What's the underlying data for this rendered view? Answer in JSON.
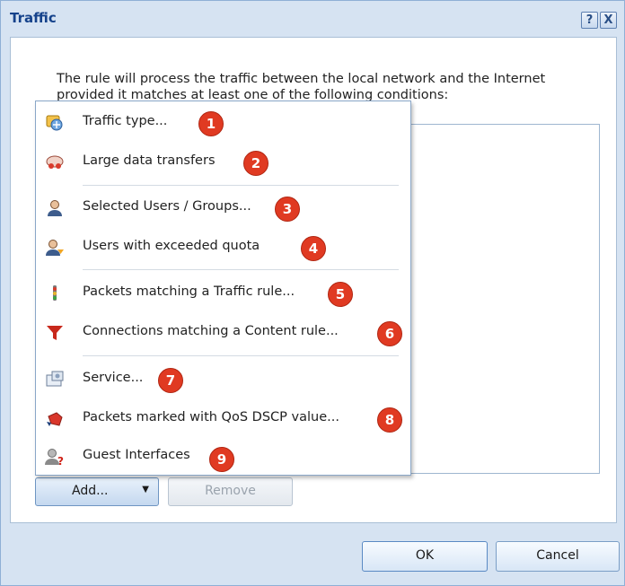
{
  "dialog": {
    "title": "Traffic",
    "help_label": "?",
    "close_label": "X",
    "description": "The rule will process the traffic between the local network and the Internet provided it matches at least one of the following conditions:"
  },
  "buttons": {
    "add_label": "Add...",
    "add_arrow": "▼",
    "remove_label": "Remove",
    "ok_label": "OK",
    "cancel_label": "Cancel"
  },
  "menu": {
    "items": [
      {
        "label": "Traffic type...",
        "badge": "1",
        "icon": "traffic-type-icon"
      },
      {
        "label": "Large data transfers",
        "badge": "2",
        "icon": "large-data-icon"
      },
      {
        "label": "Selected Users / Groups...",
        "badge": "3",
        "icon": "users-icon"
      },
      {
        "label": "Users with exceeded quota",
        "badge": "4",
        "icon": "quota-user-icon"
      },
      {
        "label": "Packets matching a Traffic rule...",
        "badge": "5",
        "icon": "traffic-rule-icon"
      },
      {
        "label": "Connections matching a Content rule...",
        "badge": "6",
        "icon": "funnel-icon"
      },
      {
        "label": "Service...",
        "badge": "7",
        "icon": "service-icon"
      },
      {
        "label": "Packets marked with QoS DSCP value...",
        "badge": "8",
        "icon": "qos-icon"
      },
      {
        "label": "Guest Interfaces",
        "badge": "9",
        "icon": "guest-icon"
      }
    ]
  },
  "colors": {
    "badge": "#e03a22",
    "title": "#15428b",
    "frame": "#d6e3f2"
  }
}
